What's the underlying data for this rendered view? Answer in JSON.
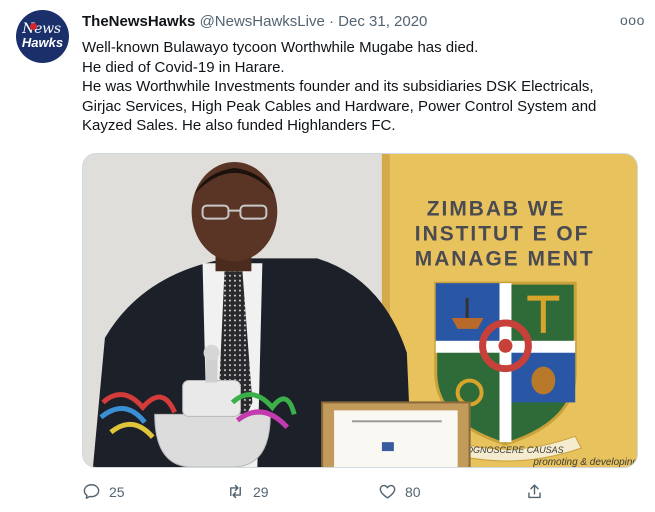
{
  "author": {
    "display_name": "TheNewsHawks",
    "handle": "@NewsHawksLive",
    "separator": "·",
    "date": "Dec 31, 2020",
    "avatar_line1": "News",
    "avatar_line2": "Hawks"
  },
  "more_menu": "ooo",
  "tweet_lines": [
    "Well-known Bulawayo tycoon Worthwhile Mugabe has died.",
    "He died of Covid-19 in Harare.",
    "He was Worthwhile Investments founder and its subsidiaries DSK Electricals,",
    "Girjac Services, High Peak Cables and Hardware, Power Control System and",
    "Kayzed Sales. He also funded Highlanders FC."
  ],
  "image": {
    "sign_lines": [
      "ZIMBAB WE",
      "INSTITUT E OF",
      "MANAGE MENT"
    ],
    "crest_motto": "COGNOSCERE CAUSAS",
    "banner_bottom": "promoting & developing"
  },
  "actions": {
    "reply_count": "25",
    "retweet_count": "29",
    "like_count": "80"
  },
  "icons": {
    "reply": "reply-icon",
    "retweet": "retweet-icon",
    "like": "heart-icon",
    "share": "share-icon"
  },
  "colors": {
    "text": "#0f1419",
    "secondary": "#536471",
    "avatar_bg": "#1b2f6b",
    "banner_yellow": "#e8c25c"
  }
}
